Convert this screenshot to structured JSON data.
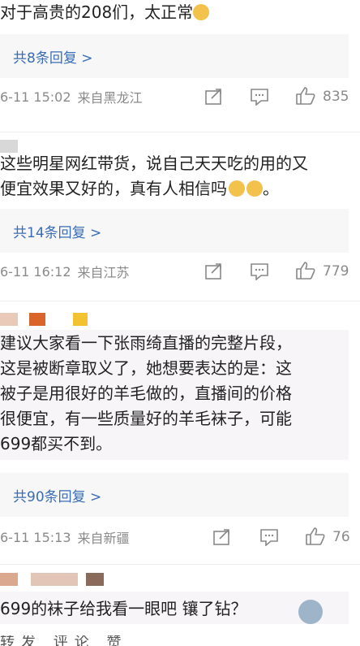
{
  "comments": [
    {
      "lines": [
        "对于高贵的208们，太正常"
      ],
      "reply_label": "共8条回复 >",
      "time": "6-11 15:02",
      "location": "来自黑龙江",
      "likes": "835"
    },
    {
      "lines": [
        "这些明星网红带货，说自己天天吃的用的又",
        "便宜效果又好的，真有人相信吗",
        "。"
      ],
      "reply_label": "共14条回复 >",
      "time": "6-11 16:12",
      "location": "来自江苏",
      "likes": "779"
    },
    {
      "lines": [
        "建议大家看一下张雨绮直播的完整片段，",
        "这是被断章取义了，她想要表达的是：这",
        "被子是用很好的羊毛做的，直播间的价格",
        "很便宜，有一些质量好的羊毛袜子，可能",
        "699都买不到。"
      ],
      "reply_label": "共90条回复 >",
      "time": "6-11 15:13",
      "location": "来自新疆",
      "likes": "76"
    },
    {
      "lines": [
        "699的袜子给我看一眼吧  镶了钻？"
      ]
    }
  ],
  "bottom_partial": "转发 评论 赞",
  "icons": {
    "share": "share-icon",
    "comment": "comment-icon",
    "like": "thumbs-up-icon"
  },
  "colors": {
    "link": "#3a6db5",
    "meta": "#8a8a8a",
    "reply_bg": "#f7f7f7"
  }
}
